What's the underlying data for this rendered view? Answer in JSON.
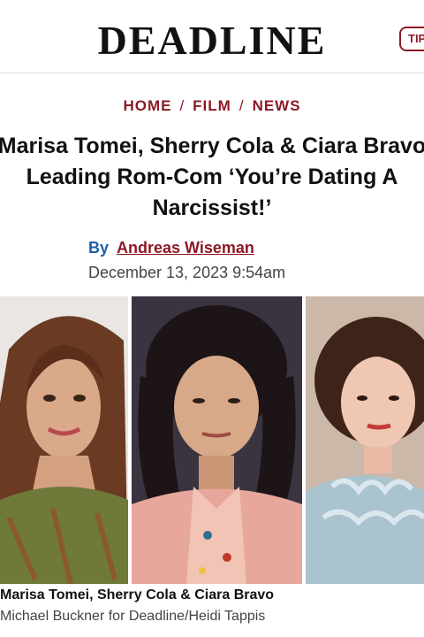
{
  "header": {
    "logo": "DEADLINE",
    "tip_button": "TIP"
  },
  "breadcrumb": [
    "HOME",
    "FILM",
    "NEWS"
  ],
  "headline": {
    "line1": "Marisa Tomei, Sherry Cola & Ciara Bravo",
    "line2": "Leading Rom-Com ‘You’re Dating A",
    "line3": "Narcissist!’"
  },
  "byline": {
    "prefix": "By",
    "author": "Andreas Wiseman",
    "date": "December 13, 2023 9:54am"
  },
  "image": {
    "caption": "Marisa Tomei, Sherry Cola & Ciara Bravo",
    "credit": "Michael Buckner for Deadline/Heidi Tappis"
  },
  "colors": {
    "brand": "#8b1a24",
    "byline": "#1f5fa8"
  }
}
